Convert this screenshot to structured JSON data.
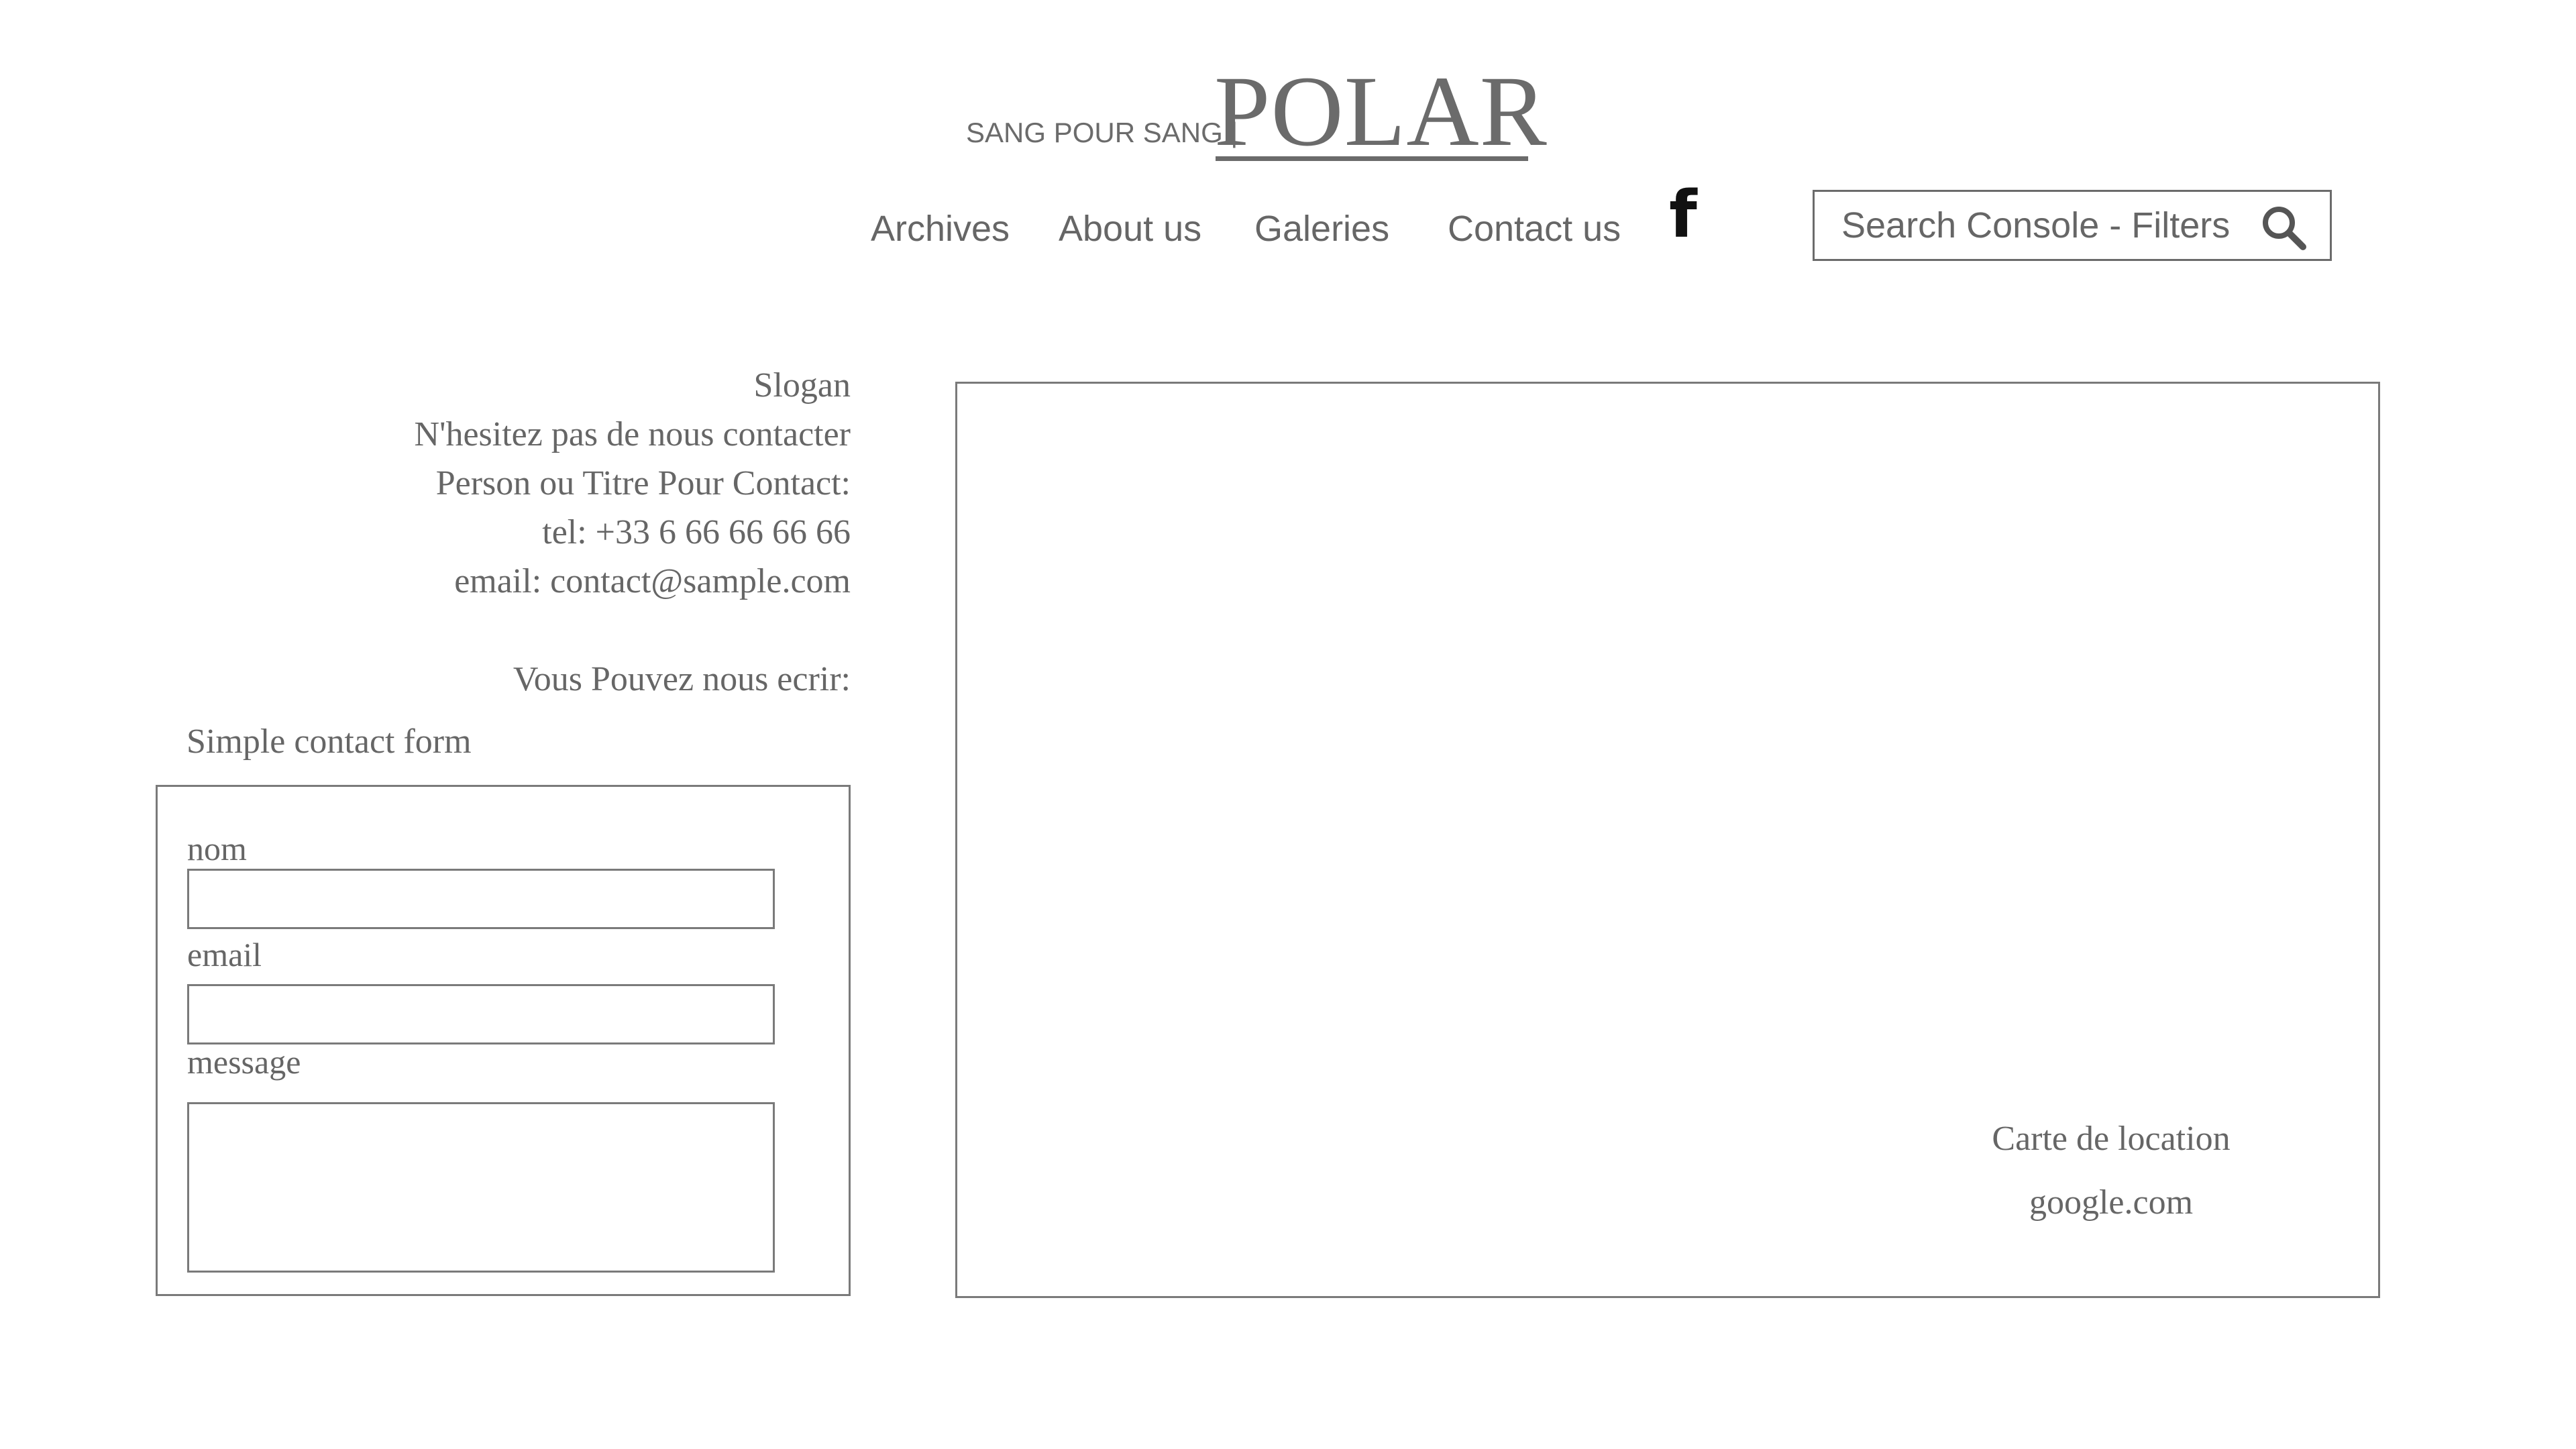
{
  "header": {
    "brand_small": "SANG POUR SANG |",
    "brand_title": "POLAR"
  },
  "nav": {
    "items": [
      {
        "label": "Archives"
      },
      {
        "label": "About us"
      },
      {
        "label": "Galeries"
      },
      {
        "label": "Contact us"
      }
    ],
    "social_icon_glyph": "f",
    "social_icon": "facebook-icon"
  },
  "search": {
    "placeholder": "Search Console - Filters",
    "icon": "search-icon"
  },
  "contact_info": {
    "slogan": "Slogan",
    "intro": "N'hesitez pas de nous contacter",
    "person": "Person ou Titre Pour Contact:",
    "tel": "tel: +33 6 66 66 66 66",
    "email": "email: contact@sample.com",
    "write_us": "Vous Pouvez nous ecrir:"
  },
  "form": {
    "title": "Simple contact form",
    "fields": [
      {
        "label": "nom",
        "value": ""
      },
      {
        "label": "email",
        "value": ""
      },
      {
        "label": "message",
        "value": ""
      }
    ]
  },
  "map": {
    "caption": "Carte de location",
    "source": "google.com"
  },
  "colors": {
    "text": "#666666",
    "border": "#7a7a7a",
    "icon": "#111111",
    "background": "#ffffff"
  }
}
